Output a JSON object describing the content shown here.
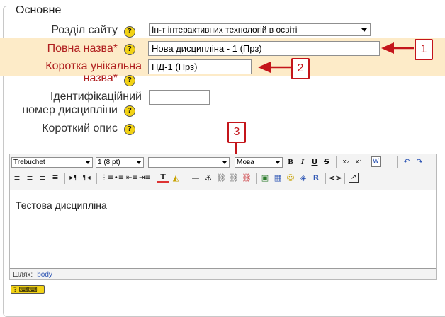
{
  "section": {
    "title": "Основне"
  },
  "fields": {
    "category": {
      "label": "Розділ сайту",
      "value": "Ін-т інтерактивних технологій в освіті"
    },
    "fullname": {
      "label": "Повна назва",
      "required_mark": "*",
      "value": "Нова дисципліна - 1 (Прз)"
    },
    "shortname": {
      "label_line1": "Коротка унікальна",
      "label_line2": "назва",
      "required_mark": "*",
      "value": "НД-1 (Прз)"
    },
    "idnumber": {
      "label_line1": "Ідентифікаційний",
      "label_line2": "номер дисципліни",
      "value": ""
    },
    "summary": {
      "label": "Короткий опис"
    }
  },
  "help_icon": {
    "glyph": "?",
    "name": "help-icon"
  },
  "callouts": {
    "one": "1",
    "two": "2",
    "three": "3"
  },
  "editor": {
    "font_family": "Trebuchet",
    "font_size": "1 (8 pt)",
    "format": "",
    "language": "Мова",
    "content": "Тестова дисципліна",
    "path_label": "Шлях:",
    "path_value": "body"
  },
  "colors": {
    "highlight_row": "#fdebc8",
    "required": "#b02020",
    "callout": "#c4151b",
    "help": "#f2d214"
  }
}
